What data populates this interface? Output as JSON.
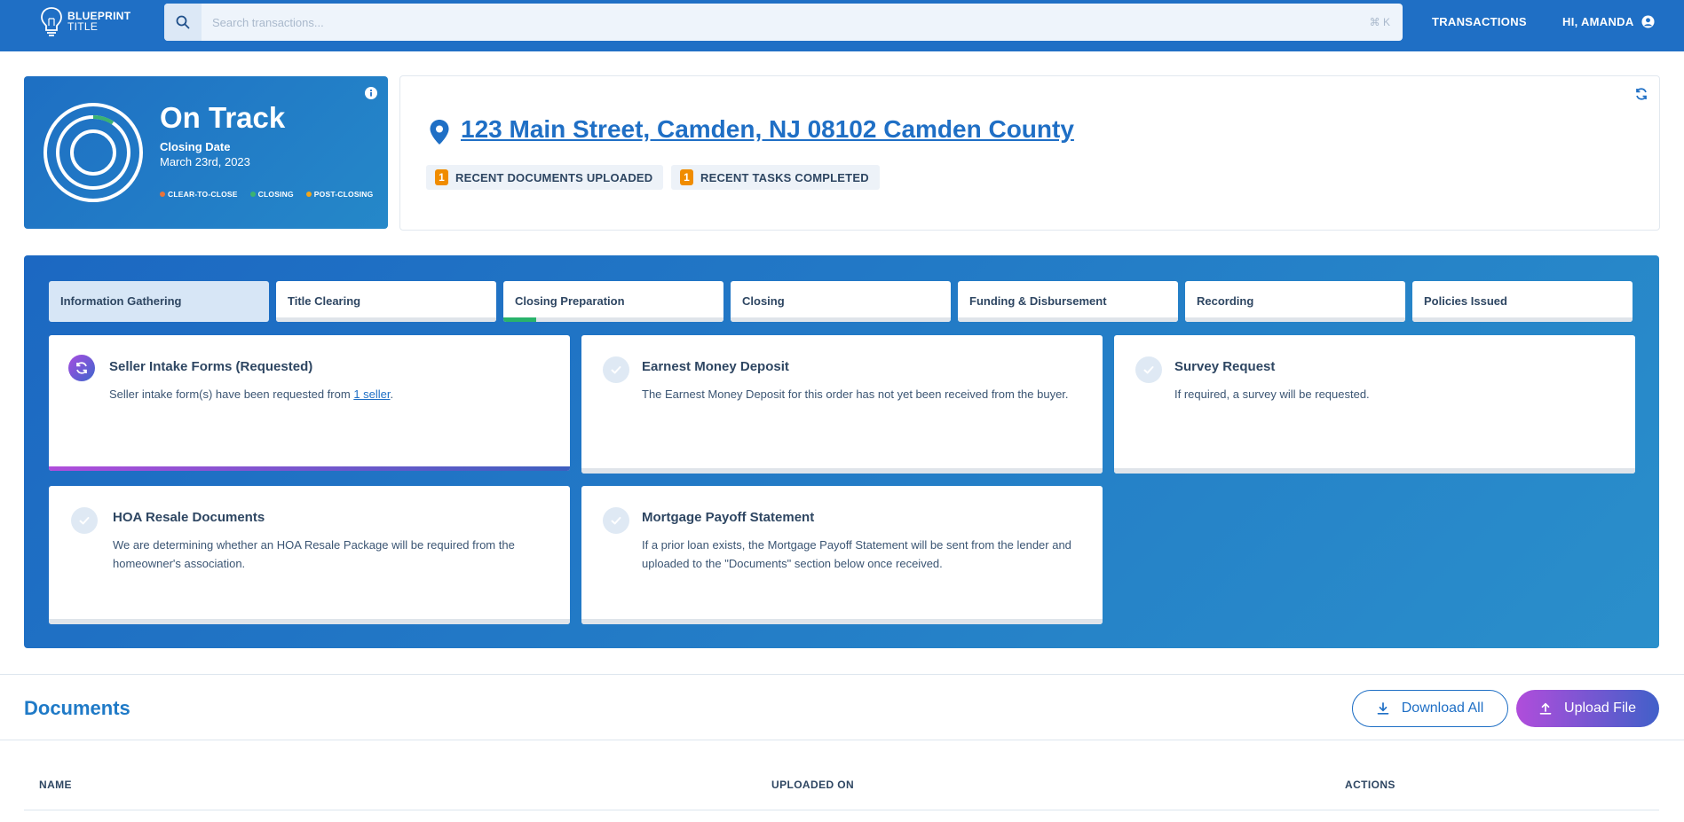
{
  "header": {
    "logo_line1": "BLUEPRINT",
    "logo_line2": "TITLE",
    "search_placeholder": "Search transactions...",
    "search_shortcut": "⌘ K",
    "nav_transactions": "TRANSACTIONS",
    "nav_user": "HI, AMANDA"
  },
  "status": {
    "title": "On Track",
    "closing_label": "Closing Date",
    "closing_date": "March 23rd, 2023",
    "legend": [
      {
        "label": "CLEAR-TO-CLOSE",
        "color": "#e8733a"
      },
      {
        "label": "CLOSING",
        "color": "#3cb371"
      },
      {
        "label": "POST-CLOSING",
        "color": "#f2a51a"
      }
    ]
  },
  "property": {
    "address": "123 Main Street, Camden, NJ 08102 Camden County",
    "badges": [
      {
        "count": "1",
        "label": "RECENT DOCUMENTS UPLOADED"
      },
      {
        "count": "1",
        "label": "RECENT TASKS COMPLETED"
      }
    ]
  },
  "workflow": {
    "tabs": [
      {
        "label": "Information Gathering",
        "active": true
      },
      {
        "label": "Title Clearing"
      },
      {
        "label": "Closing Preparation",
        "progress": 15
      },
      {
        "label": "Closing"
      },
      {
        "label": "Funding & Disbursement"
      },
      {
        "label": "Recording"
      },
      {
        "label": "Policies Issued"
      }
    ],
    "tasks": [
      {
        "title": "Seller Intake Forms (Requested)",
        "desc_before": "Seller intake form(s) have been requested from ",
        "desc_link": "1 seller",
        "desc_after": ".",
        "active": true
      },
      {
        "title": "Earnest Money Deposit",
        "desc": "The Earnest Money Deposit for this order has not yet been received from the buyer."
      },
      {
        "title": "Survey Request",
        "desc": "If required, a survey will be requested."
      },
      {
        "title": "HOA Resale Documents",
        "desc": "We are determining whether an HOA Resale Package will be required from the homeowner's association."
      },
      {
        "title": "Mortgage Payoff Statement",
        "desc": "If a prior loan exists, the Mortgage Payoff Statement will be sent from the lender and uploaded to the \"Documents\" section below once received."
      }
    ]
  },
  "documents": {
    "title": "Documents",
    "download_all": "Download All",
    "upload_file": "Upload File",
    "columns": [
      "NAME",
      "UPLOADED ON",
      "ACTIONS"
    ]
  },
  "colors": {
    "brand_blue": "#1f6fc5",
    "accent_purple": "#b04ddb",
    "progress_green": "#29b36b",
    "badge_orange": "#f08c00"
  }
}
